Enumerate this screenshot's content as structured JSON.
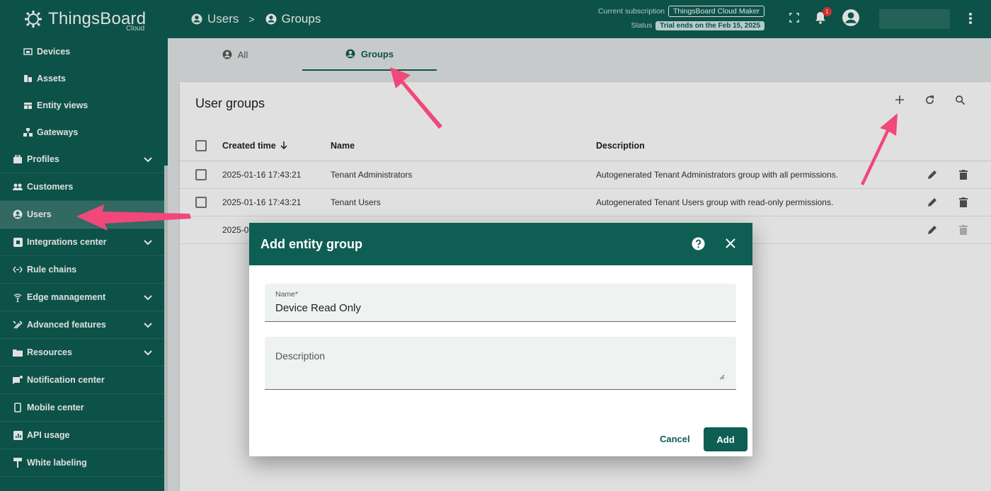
{
  "header": {
    "app_name": "ThingsBoard",
    "app_sub": "Cloud",
    "breadcrumb": [
      "Users",
      "Groups"
    ],
    "breadcrumb_sep": ">",
    "subscription_label": "Current subscription",
    "subscription_plan": "ThingsBoard Cloud Maker",
    "status_label": "Status",
    "status_value": "Trial ends on the Feb 15, 2025",
    "notification_count": "1"
  },
  "sidebar": {
    "items": [
      {
        "label": "Devices",
        "icon": "devices-icon",
        "sub": true
      },
      {
        "label": "Assets",
        "icon": "assets-icon",
        "sub": true
      },
      {
        "label": "Entity views",
        "icon": "entity-views-icon",
        "sub": true
      },
      {
        "label": "Gateways",
        "icon": "gateways-icon",
        "sub": true
      },
      {
        "label": "Profiles",
        "icon": "profiles-icon",
        "chevron": true
      },
      {
        "label": "Customers",
        "icon": "customers-icon"
      },
      {
        "label": "Users",
        "icon": "users-icon",
        "active": true
      },
      {
        "label": "Integrations center",
        "icon": "integrations-icon",
        "chevron": true
      },
      {
        "label": "Rule chains",
        "icon": "rule-chains-icon"
      },
      {
        "label": "Edge management",
        "icon": "edge-icon",
        "chevron": true
      },
      {
        "label": "Advanced features",
        "icon": "advanced-icon",
        "chevron": true
      },
      {
        "label": "Resources",
        "icon": "resources-icon",
        "chevron": true
      },
      {
        "label": "Notification center",
        "icon": "notification-center-icon"
      },
      {
        "label": "Mobile center",
        "icon": "mobile-icon"
      },
      {
        "label": "API usage",
        "icon": "api-usage-icon"
      },
      {
        "label": "White labeling",
        "icon": "white-labeling-icon"
      }
    ]
  },
  "tabs": [
    {
      "label": "All"
    },
    {
      "label": "Groups",
      "active": true
    }
  ],
  "table": {
    "title": "User groups",
    "columns": [
      "Created time",
      "Name",
      "Description"
    ],
    "rows": [
      {
        "created": "2025-01-16 17:43:21",
        "name": "Tenant Administrators",
        "description": "Autogenerated Tenant Administrators group with all permissions."
      },
      {
        "created": "2025-01-16 17:43:21",
        "name": "Tenant Users",
        "description": "Autogenerated Tenant Users group with read-only permissions."
      },
      {
        "created": "2025-0",
        "name": "",
        "description": ""
      }
    ]
  },
  "dialog": {
    "title": "Add entity group",
    "name_label": "Name*",
    "name_value": "Device Read Only",
    "description_placeholder": "Description",
    "cancel_label": "Cancel",
    "add_label": "Add"
  },
  "colors": {
    "primary": "#0e5e54",
    "annotation": "#f0487a"
  }
}
